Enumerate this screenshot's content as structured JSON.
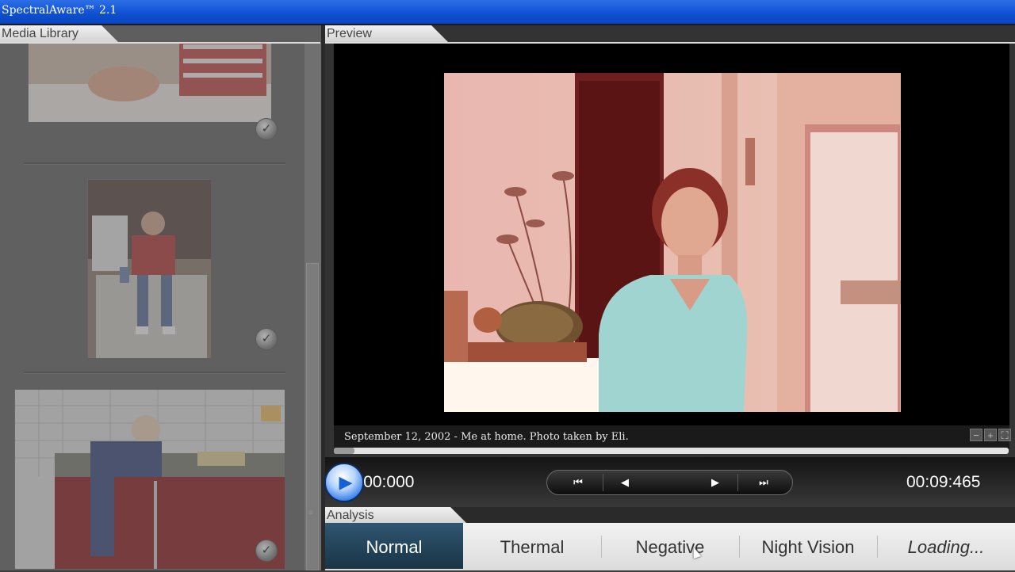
{
  "app": {
    "title": "SpectralAware™ 2.1"
  },
  "library": {
    "tab_label": "Media Library",
    "check_glyph": "✓"
  },
  "preview": {
    "tab_label": "Preview",
    "caption": "September 12, 2002 - Me at home. Photo taken by Eli.",
    "zoom_out": "−",
    "zoom_in": "+",
    "fit": "⛶",
    "progress_fraction": 0.03
  },
  "transport": {
    "current_time": "00:00:000",
    "total_time": "00:09:465",
    "first_glyph": "⏮",
    "prev_glyph": "◀",
    "play_glyph": "▶",
    "next_glyph": "▶",
    "last_glyph": "⏭"
  },
  "analysis": {
    "tab_label": "Analysis",
    "tabs": [
      "Normal",
      "Thermal",
      "Negative",
      "Night Vision",
      "Loading..."
    ],
    "active_tab": "Normal"
  },
  "colors": {
    "titlebar": "#0d4fd0",
    "accent_play": "#3d83ea",
    "active_tab": "#244558"
  }
}
